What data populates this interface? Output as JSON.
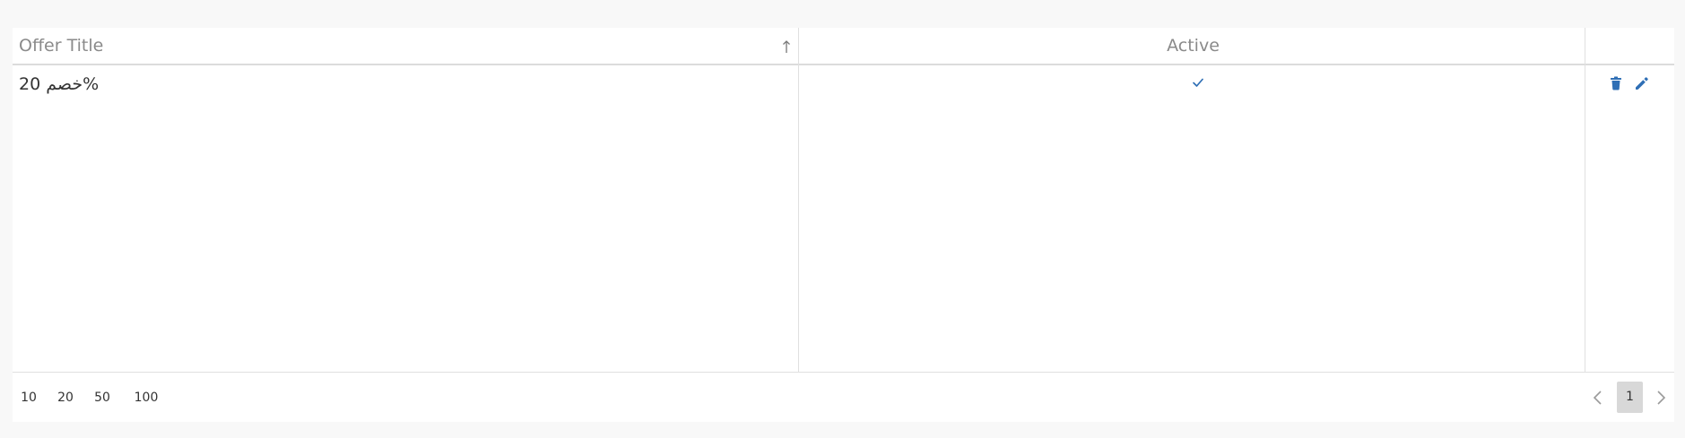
{
  "grid": {
    "columns": [
      {
        "title": "Offer Title",
        "sort": "ascending"
      },
      {
        "title": "Active"
      },
      {
        "title": ""
      }
    ],
    "rows": [
      {
        "offer_title": "خصم 20%",
        "active": true
      }
    ]
  },
  "footer": {
    "page_sizes": [
      "10",
      "20",
      "50",
      "100"
    ],
    "current_page": "1"
  },
  "colors": {
    "accent": "#2f6fb5",
    "header_text": "#8a8a8a",
    "body_text": "#333333",
    "current_page_bg": "#d8d8d8"
  },
  "icons": {
    "sort": "sort-up-arrow-icon",
    "active": "check-icon",
    "delete": "trash-icon",
    "edit": "pencil-icon",
    "prev": "chevron-left-icon",
    "next": "chevron-right-icon"
  }
}
